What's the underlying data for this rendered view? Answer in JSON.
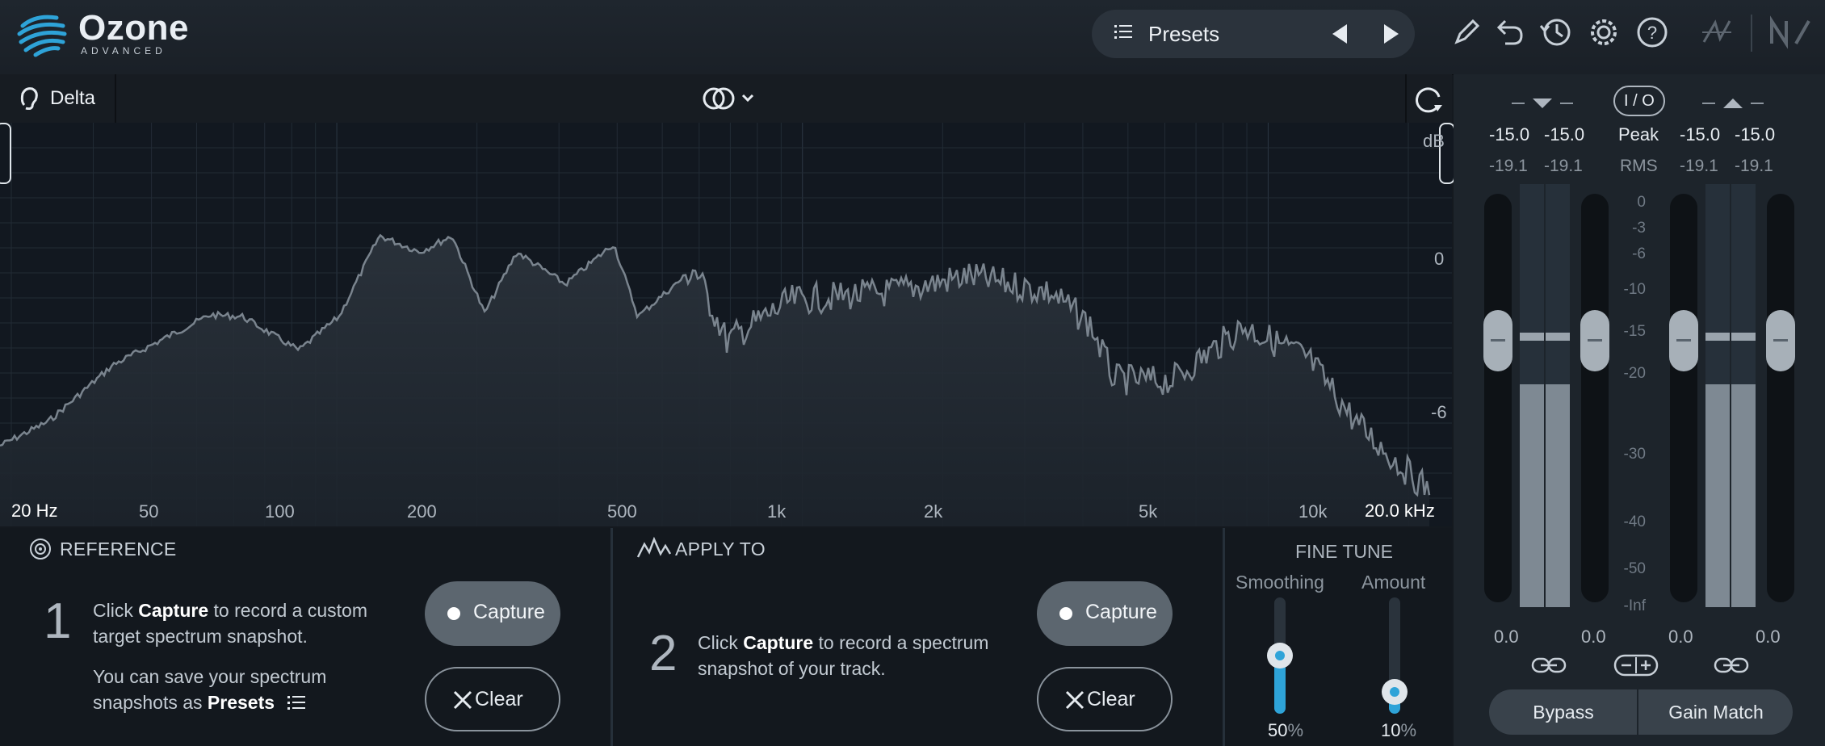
{
  "app": {
    "name": "Ozone",
    "edition": "ADVANCED"
  },
  "header": {
    "presets_label": "Presets"
  },
  "analyzer": {
    "delta_label": "Delta",
    "freq_labels": [
      "20 Hz",
      "50",
      "100",
      "200",
      "500",
      "1k",
      "2k",
      "5k",
      "10k",
      "20.0 kHz"
    ],
    "db_labels": [
      "dB",
      "0",
      "-6"
    ]
  },
  "reference": {
    "title": "REFERENCE",
    "step": "1",
    "text_pre": "Click ",
    "text_bold": "Capture",
    "text_post": " to record a custom",
    "text_line2": "target spectrum snapshot.",
    "save_line1": "You can save your spectrum",
    "save_pre": "snapshots as ",
    "save_bold": "Presets",
    "capture_label": "Capture",
    "clear_label": "Clear"
  },
  "apply": {
    "title": "APPLY TO",
    "step": "2",
    "text_pre": "Click ",
    "text_bold": "Capture",
    "text_post": " to record a spectrum",
    "text_line2": "snapshot of your track.",
    "capture_label": "Capture",
    "clear_label": "Clear"
  },
  "fine_tune": {
    "title": "FINE TUNE",
    "smoothing_label": "Smoothing",
    "amount_label": "Amount",
    "smoothing_value": "50",
    "amount_value": "10",
    "unit": "%",
    "smoothing_level": 0.5,
    "amount_level": 0.1
  },
  "meters": {
    "io_label": "I / O",
    "peak_label": "Peak",
    "rms_label": "RMS",
    "in_peak_l": "-15.0",
    "in_peak_r": "-15.0",
    "in_rms_l": "-19.1",
    "in_rms_r": "-19.1",
    "out_peak_l": "-15.0",
    "out_peak_r": "-15.0",
    "out_rms_l": "-19.1",
    "out_rms_r": "-19.1",
    "scale": [
      "0",
      "-3",
      "-6",
      "-10",
      "-15",
      "-20",
      "-30",
      "-40",
      "-50",
      "-Inf"
    ],
    "gain_values": [
      "0.0",
      "0.0",
      "0.0",
      "0.0"
    ],
    "bypass_label": "Bypass",
    "gain_match_label": "Gain Match"
  },
  "colors": {
    "accent": "#2ea3d8",
    "background": "#14191f",
    "spectrum_line": "#7a848e"
  }
}
